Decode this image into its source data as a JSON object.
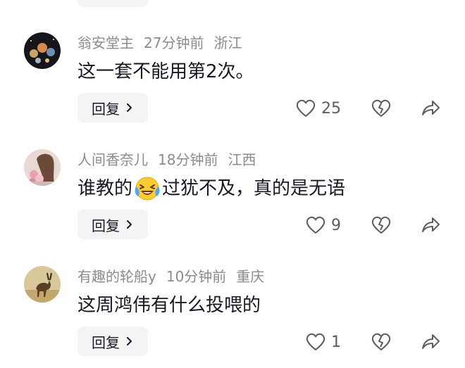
{
  "comments": [
    {
      "username": "翁安堂主",
      "time": "27分钟前",
      "location": "浙江",
      "text_before": "这一套不能用第2次。",
      "emoji": "",
      "text_after": "",
      "reply_label": "回复",
      "likes": "25"
    },
    {
      "username": "人间香奈儿",
      "time": "18分钟前",
      "location": "江西",
      "text_before": "谁教的",
      "emoji": "laughing-crying-emoji",
      "text_after": "过犹不及，真的是无语",
      "reply_label": "回复",
      "likes": "9"
    },
    {
      "username": "有趣的轮船y",
      "time": "10分钟前",
      "location": "重庆",
      "text_before": "这周鸿伟有什么投喂的",
      "emoji": "",
      "text_after": "",
      "reply_label": "回复",
      "likes": "1"
    }
  ],
  "colors": {
    "meta": "#8a8b91",
    "text": "#161823",
    "button_bg": "#f4f4f5",
    "icon": "#5c5d64"
  }
}
